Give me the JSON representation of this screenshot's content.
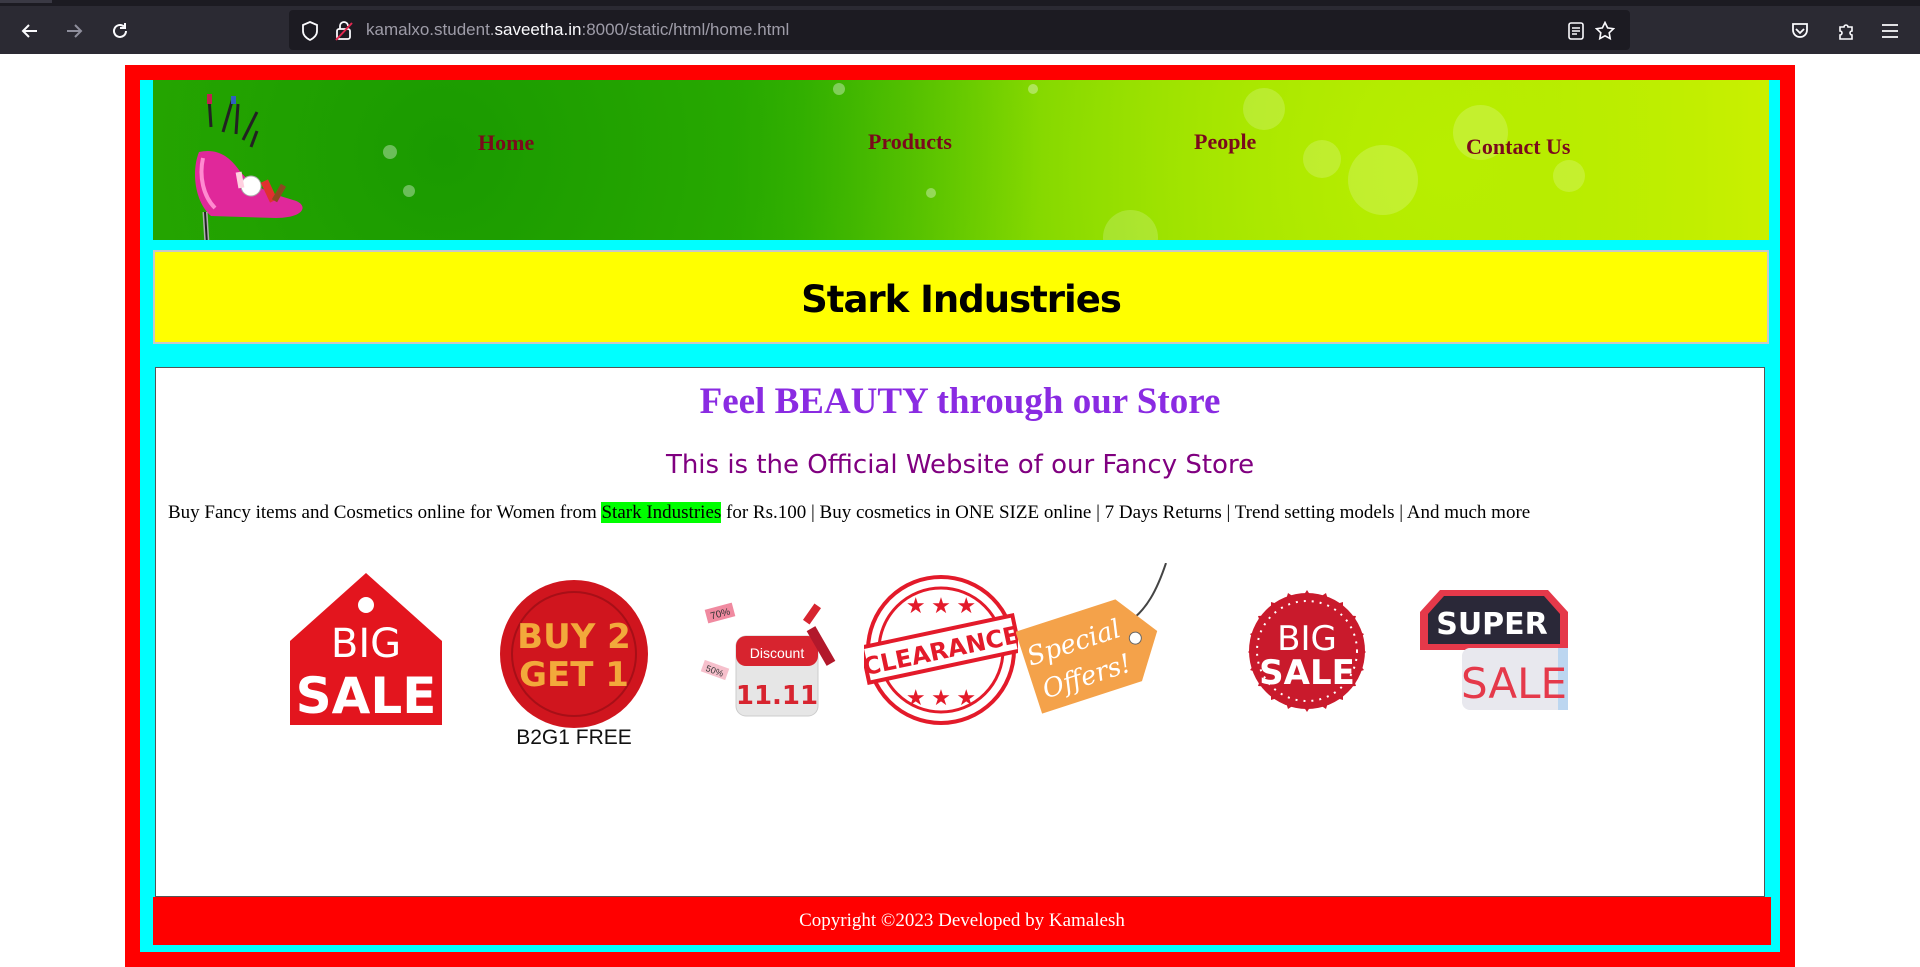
{
  "browser": {
    "url_prefix": "kamalxo.student.",
    "url_domain": "saveetha.in",
    "url_suffix": ":8000/static/html/home.html"
  },
  "nav": {
    "home": "Home",
    "products": "Products",
    "people": "People",
    "contact": "Contact Us"
  },
  "company": "Stark Industries",
  "content": {
    "heading": "Feel BEAUTY through our Store",
    "subheading": "This is the Official Website of our Fancy Store",
    "para_before": "Buy Fancy items and Cosmetics online for Women from ",
    "para_highlight": "Stark Industries",
    "para_after": " for Rs.100 | Buy cosmetics in ONE SIZE online | 7 Days Returns | Trend setting models | And much more"
  },
  "badges": {
    "big_sale_tag": {
      "line1": "BIG",
      "line2": "SALE"
    },
    "buy2get1": {
      "line1": "BUY 2",
      "line2": "GET 1",
      "caption": "B2G1 FREE"
    },
    "discount": {
      "label": "Discount",
      "date": "11.11",
      "chip1": "70%",
      "chip2": "50%"
    },
    "clearance": {
      "label": "CLEARANCE"
    },
    "special": {
      "line1": "Special",
      "line2": "Offers!"
    },
    "big_sale_seal": {
      "line1": "BIG",
      "line2": "SALE"
    },
    "super_sale": {
      "line1": "SUPER",
      "line2": "SALE"
    }
  },
  "footer": "Copyright ©2023 Developed by Kamalesh",
  "colors": {
    "frame": "#ff0000",
    "inner": "#00ffff",
    "title_bg": "#ffff00",
    "heading": "#8a2be2",
    "subheading": "#800080",
    "nav": "#7a0a1c",
    "highlight": "#00ff00"
  }
}
